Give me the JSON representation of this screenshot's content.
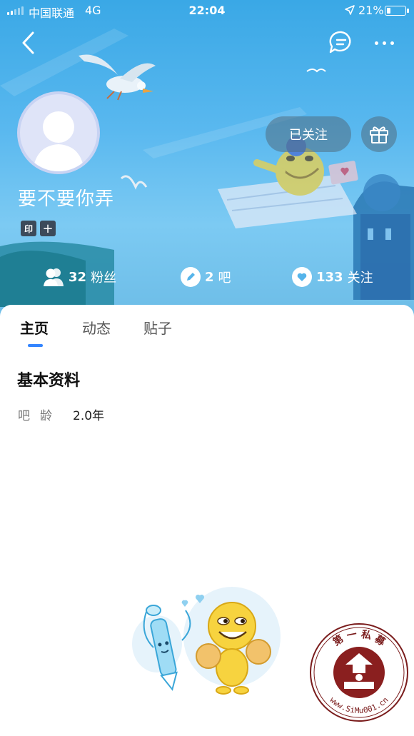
{
  "status_bar": {
    "carrier": "中国联通",
    "network": "4G",
    "time": "22:04",
    "battery": "21%",
    "battery_level": 0.21
  },
  "nav": {
    "back_icon": "chevron-left-icon",
    "message_icon": "chat-bubble-icon",
    "more_icon": "more-dots-icon"
  },
  "profile": {
    "username": "要不要你弄",
    "follow_label": "已关注",
    "badges": [
      "印",
      "+"
    ],
    "stats": {
      "fans_count": "32",
      "fans_label": "粉丝",
      "bar_count": "2",
      "bar_label": "吧",
      "follow_count": "133",
      "follow_label": "关注"
    }
  },
  "tabs": [
    {
      "label": "主页",
      "active": true
    },
    {
      "label": "动态",
      "active": false
    },
    {
      "label": "贴子",
      "active": false
    }
  ],
  "basic_info": {
    "title": "基本资料",
    "rows": [
      {
        "label": "吧龄",
        "value": "2.0年"
      }
    ]
  },
  "watermark": {
    "top_text": "第 一 私 募",
    "bottom_text": "www.SiMu001.cn"
  },
  "colors": {
    "accent": "#3385ff",
    "hero_sky": "#4fb2ec"
  }
}
